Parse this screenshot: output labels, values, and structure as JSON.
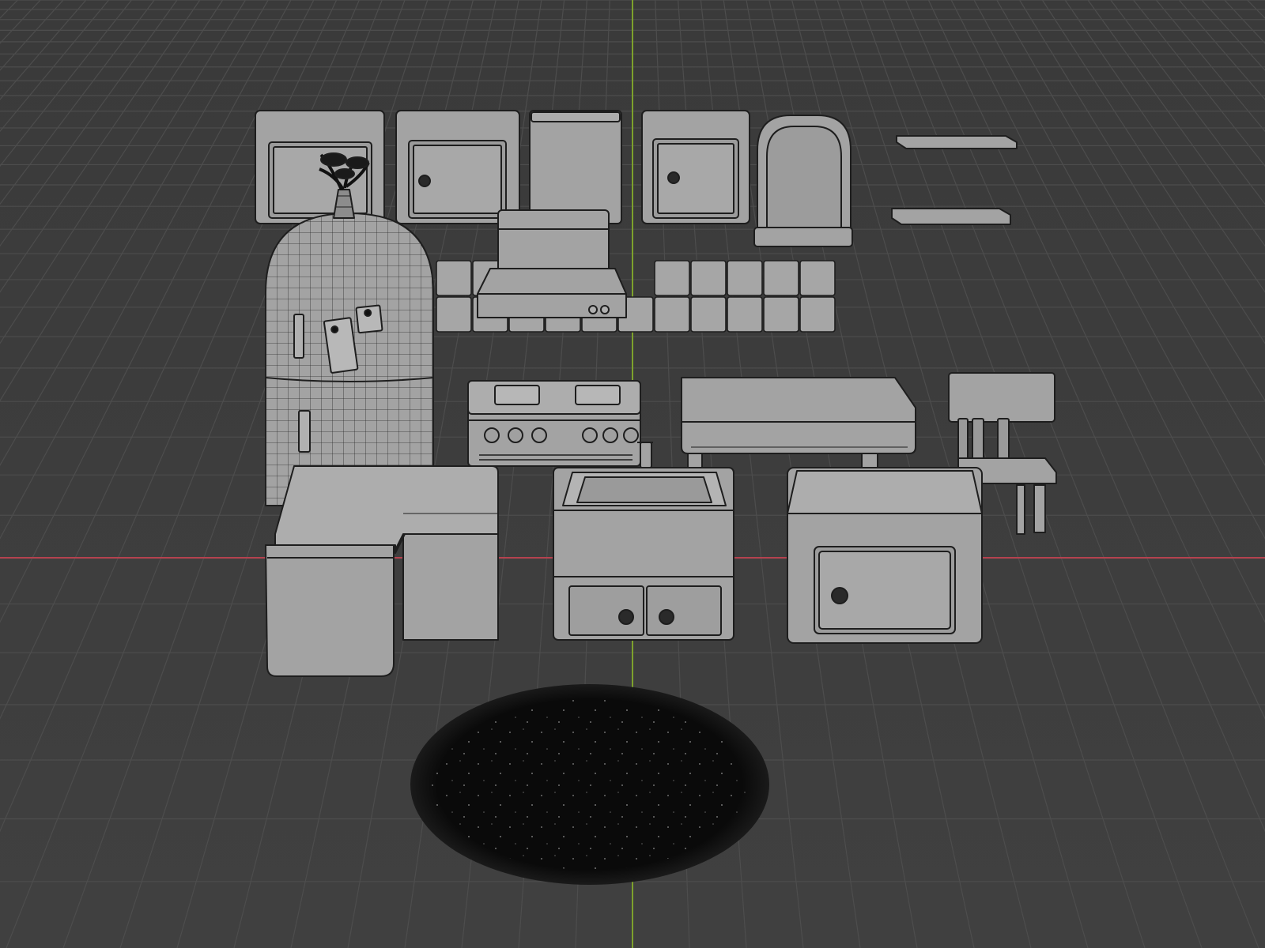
{
  "viewport": {
    "view": "3d-viewport",
    "shading": "solid-with-wireframe",
    "background_color": "#3d3d3d",
    "grid_line_color": "#4d4d4d",
    "x_axis_color": "#b5424f",
    "y_axis_color": "#7da12c",
    "object_fill": "#a3a3a3",
    "object_edge": "#1e1e1e",
    "rug_color": "#0a0a0a"
  },
  "scene_objects": [
    {
      "id": "wall-cabinet-1",
      "type": "wall-cabinet",
      "has_knob": false
    },
    {
      "id": "wall-cabinet-2",
      "type": "wall-cabinet",
      "has_knob": true
    },
    {
      "id": "wall-cabinet-3",
      "type": "wall-cabinet-plain",
      "has_knob": false
    },
    {
      "id": "wall-cabinet-4",
      "type": "wall-cabinet",
      "has_knob": true
    },
    {
      "id": "arched-window",
      "type": "window"
    },
    {
      "id": "shelf-top",
      "type": "wall-shelf"
    },
    {
      "id": "shelf-bottom",
      "type": "wall-shelf"
    },
    {
      "id": "plant-pot",
      "type": "decor"
    },
    {
      "id": "refrigerator",
      "type": "fridge",
      "magnets": 2
    },
    {
      "id": "range-hood",
      "type": "hood",
      "buttons": 2
    },
    {
      "id": "backsplash-tiles",
      "type": "tiles",
      "rows": 2
    },
    {
      "id": "stove",
      "type": "stove",
      "burners": 2,
      "knobs": 6
    },
    {
      "id": "dining-table",
      "type": "table"
    },
    {
      "id": "chair",
      "type": "chair"
    },
    {
      "id": "corner-counter",
      "type": "counter"
    },
    {
      "id": "sink-cabinet",
      "type": "sink",
      "drawers": 2
    },
    {
      "id": "base-cabinet",
      "type": "cabinet",
      "has_knob": true
    },
    {
      "id": "round-rug",
      "type": "rug",
      "shape": "circle"
    }
  ]
}
